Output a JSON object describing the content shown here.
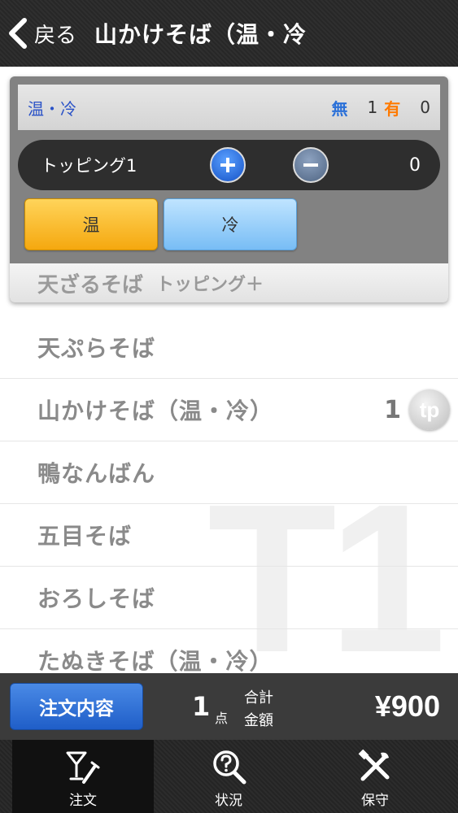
{
  "header": {
    "back_label": "戻る",
    "title": "山かけそば（温・冷"
  },
  "menu": {
    "watermark": "T1",
    "items": [
      {
        "label": "天ぷらそば",
        "qty": ""
      },
      {
        "label": "山かけそば（温・冷）",
        "qty": "1",
        "badge": "tp"
      },
      {
        "label": "鴨なんばん",
        "qty": ""
      },
      {
        "label": "五目そば",
        "qty": ""
      },
      {
        "label": "おろしそば",
        "qty": ""
      },
      {
        "label": "たぬきそば（温・冷）",
        "qty": ""
      }
    ]
  },
  "popup": {
    "option_group_label": "温・冷",
    "none_label": "無",
    "none_count": "1",
    "yes_label": "有",
    "yes_count": "0",
    "topping_label": "トッピング1",
    "topping_count": "0",
    "options": [
      {
        "label": "温",
        "color": "#f5b21e"
      },
      {
        "label": "冷",
        "color": "#8ecbf7"
      }
    ],
    "footer_item": "天ざるそば",
    "footer_topping": "トッピング＋"
  },
  "summary": {
    "order_button": "注文内容",
    "count": "1",
    "count_unit": "点",
    "total_label_1": "合計",
    "total_label_2": "金額",
    "amount": "¥900"
  },
  "tabs": [
    {
      "label": "注文",
      "icon": "cocktail-fork-icon",
      "active": true
    },
    {
      "label": "状況",
      "icon": "magnifier-question-icon",
      "active": false
    },
    {
      "label": "保守",
      "icon": "tools-icon",
      "active": false
    }
  ]
}
